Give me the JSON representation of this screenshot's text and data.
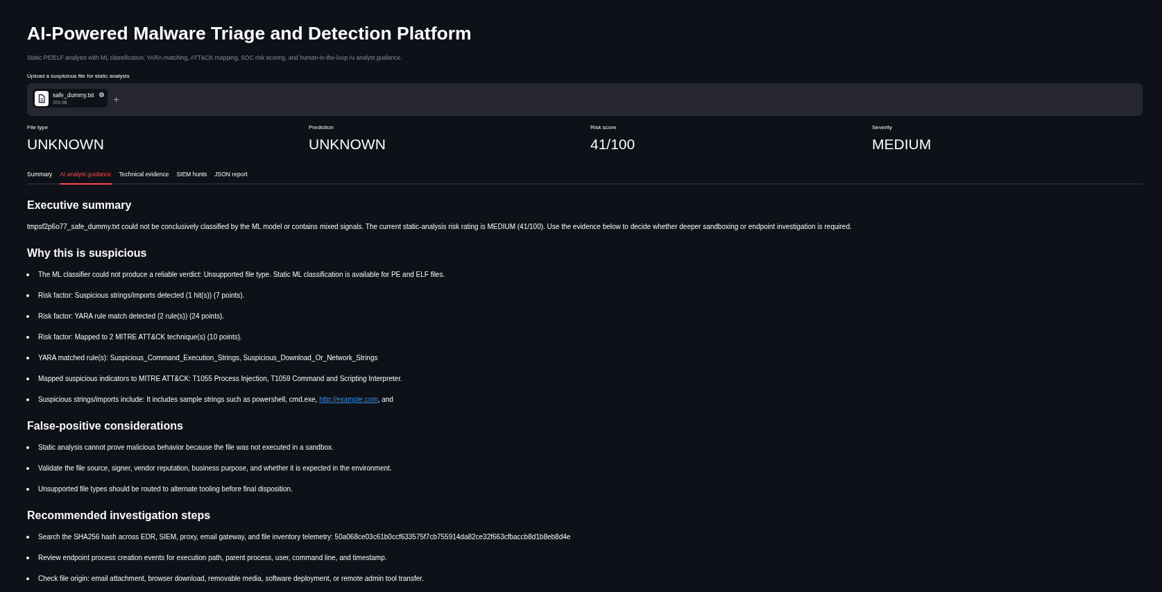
{
  "header": {
    "title": "AI-Powered Malware Triage and Detection Platform",
    "subtitle": "Static PE/ELF analysis with ML classification, YARA matching, ATT&CK mapping, SOC risk scoring, and human-in-the-loop AI analyst guidance."
  },
  "uploader": {
    "label": "Upload a suspicious file for static analysis",
    "file": {
      "name": "safe_dummy.txt",
      "size": "209.0B"
    }
  },
  "metrics": [
    {
      "label": "File type",
      "value": "UNKNOWN"
    },
    {
      "label": "Prediction",
      "value": "UNKNOWN"
    },
    {
      "label": "Risk score",
      "value": "41/100"
    },
    {
      "label": "Severity",
      "value": "MEDIUM"
    }
  ],
  "tabs": [
    {
      "label": "Summary",
      "selected": false
    },
    {
      "label": "AI analyst guidance",
      "selected": true
    },
    {
      "label": "Technical evidence",
      "selected": false
    },
    {
      "label": "SIEM hunts",
      "selected": false
    },
    {
      "label": "JSON report",
      "selected": false
    }
  ],
  "sections": [
    {
      "heading": "Executive summary",
      "kind": "paragraph",
      "text": "tmpsf2p6o77_safe_dummy.txt could not be conclusively classified by the ML model or contains mixed signals. The current static-analysis risk rating is MEDIUM (41/100). Use the evidence below to decide whether deeper sandboxing or endpoint investigation is required."
    },
    {
      "heading": "Why this is suspicious",
      "kind": "bullets",
      "items": [
        {
          "text": "The ML classifier could not produce a reliable verdict: Unsupported file type. Static ML classification is available for PE and ELF files."
        },
        {
          "text": "Risk factor: Suspicious strings/imports detected (1 hit(s)) (7 points)."
        },
        {
          "text": "Risk factor: YARA rule match detected (2 rule(s)) (24 points)."
        },
        {
          "text": "Risk factor: Mapped to 2 MITRE ATT&CK technique(s) (10 points)."
        },
        {
          "text": "YARA matched rule(s): Suspicious_Command_Execution_Strings, Suspicious_Download_Or_Network_Strings"
        },
        {
          "text": "Mapped suspicious indicators to MITRE ATT&CK: T1055 Process Injection, T1059 Command and Scripting Interpreter."
        },
        {
          "text": "Suspicious strings/imports include: It includes sample strings such as powershell, cmd.exe, ",
          "link": "http://example.com",
          "after": ", and"
        }
      ]
    },
    {
      "heading": "False-positive considerations",
      "kind": "bullets",
      "items": [
        {
          "text": "Static analysis cannot prove malicious behavior because the file was not executed in a sandbox."
        },
        {
          "text": "Validate the file source, signer, vendor reputation, business purpose, and whether it is expected in the environment."
        },
        {
          "text": "Unsupported file types should be routed to alternate tooling before final disposition."
        }
      ]
    },
    {
      "heading": "Recommended investigation steps",
      "kind": "bullets",
      "items": [
        {
          "text": "Search the SHA256 hash across EDR, SIEM, proxy, email gateway, and file inventory telemetry: 50a068ce03c61b0ccf633575f7cb755914da82ce32f663cfbaccb8d1b8eb8d4e"
        },
        {
          "text": "Review endpoint process creation events for execution path, parent process, user, command line, and timestamp."
        },
        {
          "text": "Check file origin: email attachment, browser download, removable media, software deployment, or remote admin tool transfer."
        }
      ]
    }
  ]
}
